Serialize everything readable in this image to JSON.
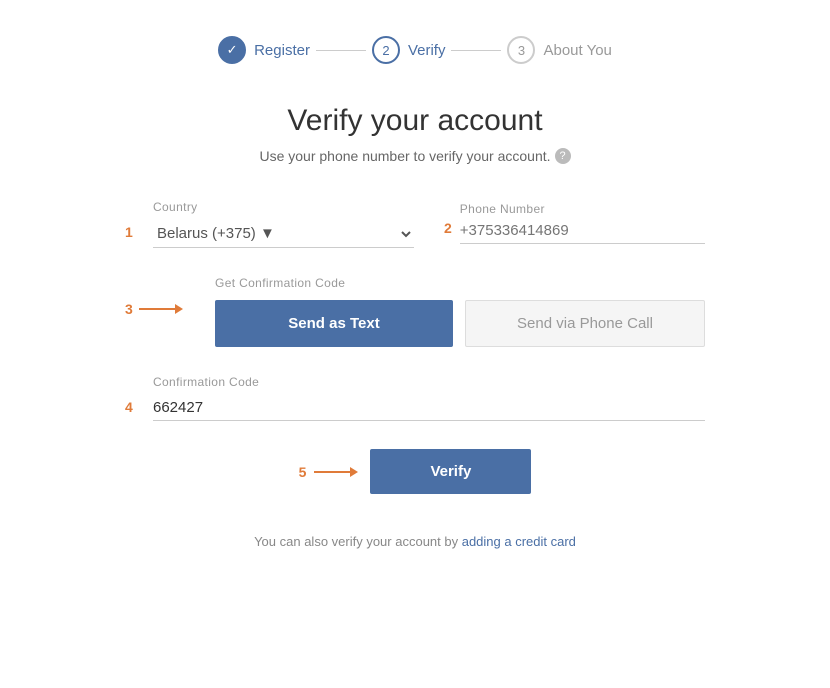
{
  "stepper": {
    "steps": [
      {
        "id": "register",
        "label": "Register",
        "number": "✓",
        "state": "completed"
      },
      {
        "id": "verify",
        "label": "Verify",
        "number": "2",
        "state": "active"
      },
      {
        "id": "about",
        "label": "About You",
        "number": "3",
        "state": "inactive"
      }
    ]
  },
  "page": {
    "title": "Verify your account",
    "subtitle": "Use your phone number to verify your account.",
    "help_icon": "?"
  },
  "form": {
    "step1_num": "1",
    "step2_num": "2",
    "step3_num": "3",
    "step4_num": "4",
    "step5_num": "5",
    "country_label": "Country",
    "country_value": "Belarus (+375) ▼",
    "phone_label": "Phone Number",
    "phone_placeholder": "+375336414869",
    "confirmation_code_label": "Get Confirmation Code",
    "send_text_label": "Send as Text",
    "send_call_label": "Send via Phone Call",
    "code_label": "Confirmation Code",
    "code_value": "662427",
    "verify_label": "Verify",
    "bottom_text_prefix": "You can also verify your account by ",
    "bottom_link_text": "adding a credit card",
    "bottom_text_suffix": ""
  }
}
